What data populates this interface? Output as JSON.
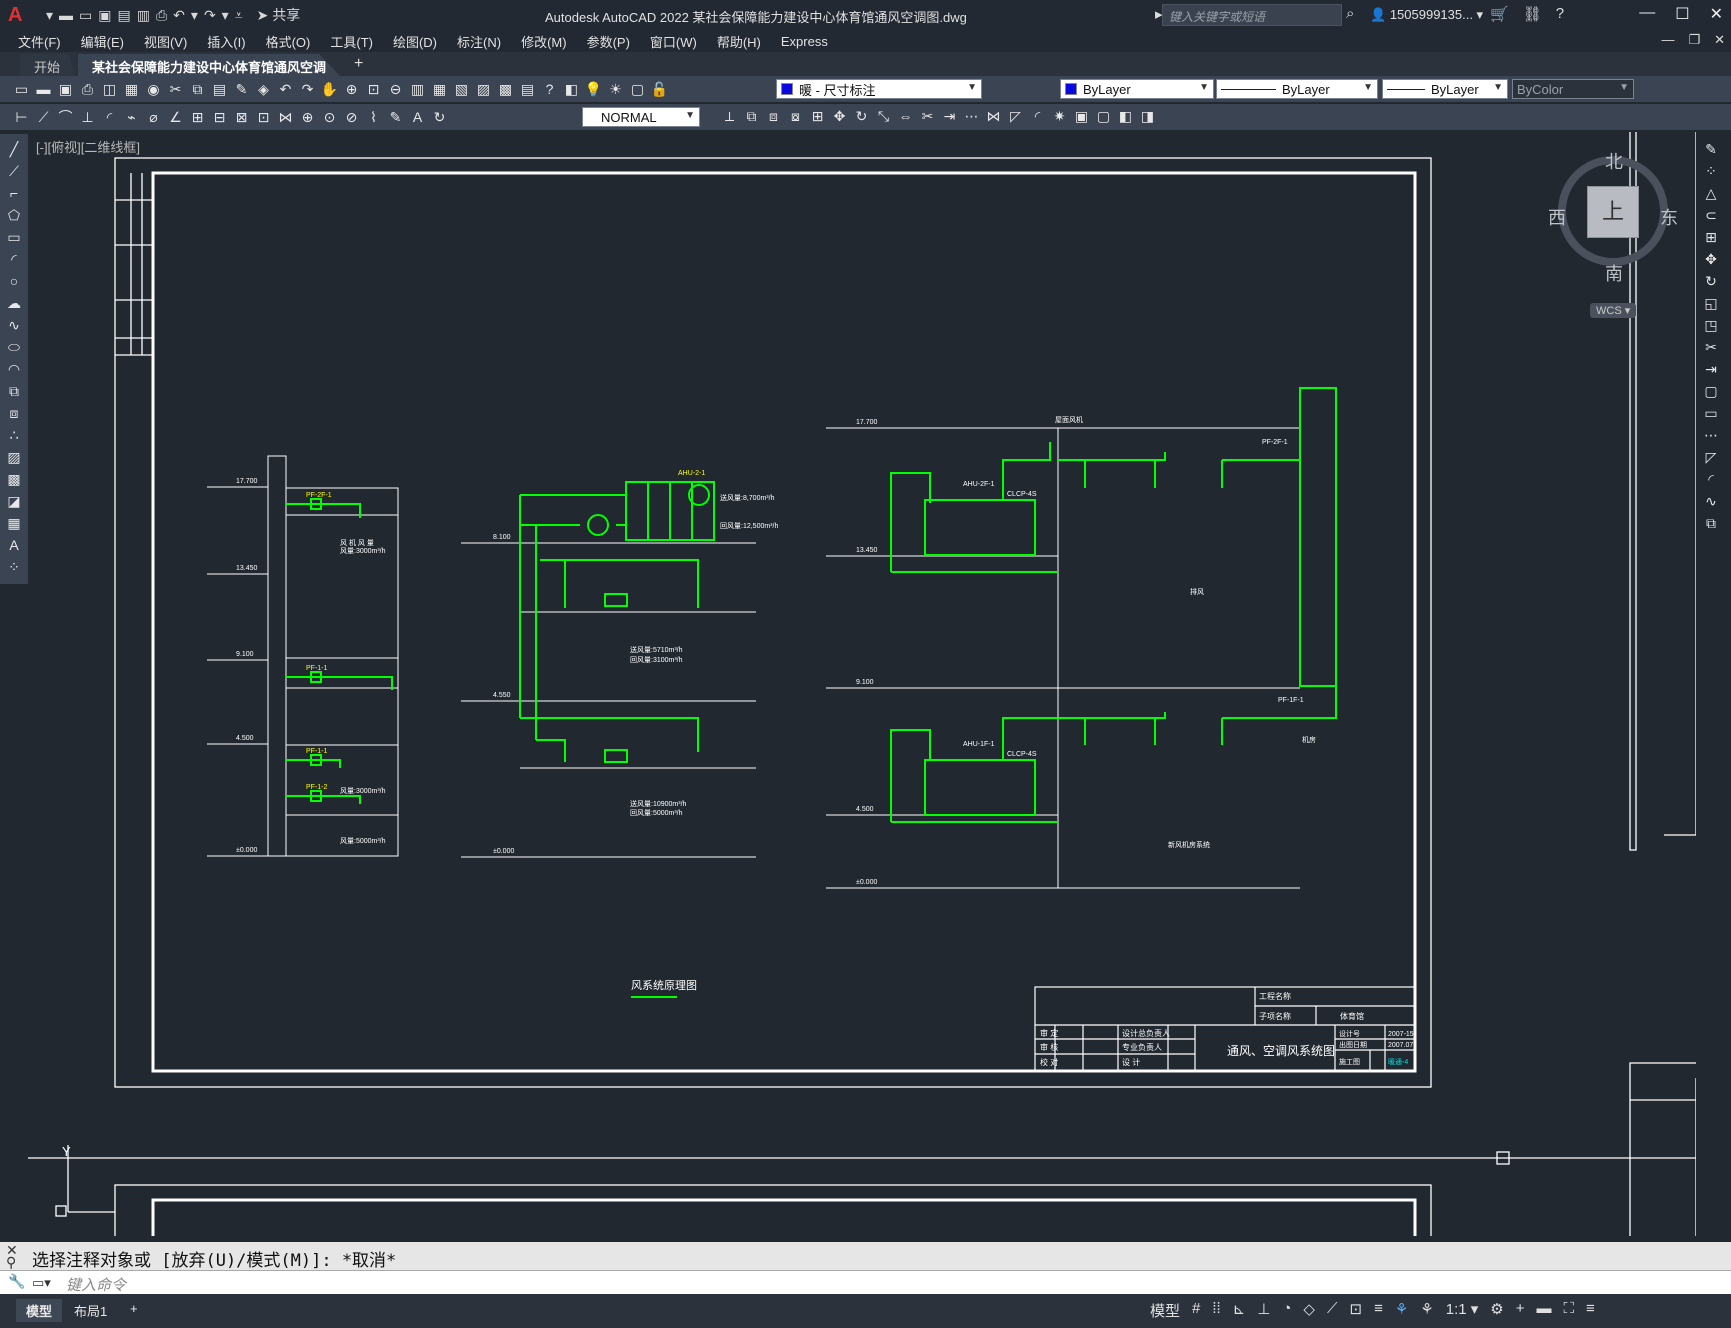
{
  "app": {
    "title": "Autodesk AutoCAD 2022    某社会保障能力建设中心体育馆通风空调图.dwg",
    "logo": "A",
    "share": "共享",
    "search_placeholder": "键入关键字或短语",
    "user": "1505999135... ▾"
  },
  "menu": [
    "文件(F)",
    "编辑(E)",
    "视图(V)",
    "插入(I)",
    "格式(O)",
    "工具(T)",
    "绘图(D)",
    "标注(N)",
    "修改(M)",
    "参数(P)",
    "窗口(W)",
    "帮助(H)",
    "Express"
  ],
  "tabs": {
    "start": "开始",
    "active": "某社会保障能力建设中心体育馆通风空调图*",
    "close": "×",
    "add": "+"
  },
  "toolbar": {
    "layer_combo": "暖 - 尺寸标注",
    "color_combo": "ByLayer",
    "linetype_combo": "ByLayer",
    "lineweight_combo": "ByLayer",
    "plotstyle_combo": "ByColor",
    "dimstyle_combo": "NORMAL"
  },
  "viewport": {
    "label": "[-][俯视][二维线框]",
    "viewcube": {
      "top": "上",
      "north": "北",
      "south": "南",
      "west": "西",
      "east": "东"
    },
    "wcs": "WCS ▾"
  },
  "drawing": {
    "caption": "风系统原理图",
    "levels_left": [
      "17.700",
      "13.450",
      "9.100",
      "4.500",
      "±0.000"
    ],
    "left_units": [
      "PF-2F-1",
      "PF-1-1",
      "PF-1-1",
      "PF-1-2"
    ],
    "left_notes": [
      "风 机 风 量",
      "风量:3000m³/h",
      "风量:3000m³/h",
      "风量:5000m³/h"
    ],
    "mid_unit": "AHU-2-1",
    "mid_notes": [
      "送风量:8,700m³/h",
      "回风量:12,500m³/h",
      "送风量:5710m³/h",
      "回风量:3100m³/h",
      "送风量:10900m³/h",
      "回风量:5000m³/h"
    ],
    "mid_levels": [
      "8.100",
      "4.550",
      "±0.000"
    ],
    "right_units": [
      "AHU-2F-1",
      "CLCP-4S",
      "AHU-1F-1",
      "CLCP-4S",
      "PF-2F-1",
      "PF-1F-1"
    ],
    "right_levels": [
      "17.700",
      "13.450",
      "9.100",
      "4.500",
      "±0.000"
    ],
    "right_notes": [
      "屋面风机",
      "排风",
      "机房",
      "新风机房系统"
    ],
    "titleblock": {
      "drawing_name": "通风、空调风系统图",
      "project": "工程名称",
      "sub": "子项名称",
      "sub_value": "体育馆",
      "roles": [
        "审 定",
        "审 核",
        "校 对"
      ],
      "roles2": [
        "设计总负责人",
        "专业负责人",
        "设 计"
      ],
      "meta": [
        "设计号",
        "2007-15",
        "出图日期",
        "2007.07",
        "施工图",
        "暖通-4"
      ]
    }
  },
  "command": {
    "history": "选择注释对象或 [放弃(U)/模式(M)]: *取消*",
    "placeholder": "键入命令"
  },
  "layout_tabs": [
    "模型",
    "布局1",
    "+"
  ],
  "status": {
    "model": "模型",
    "scale": "1:1 ▾"
  }
}
